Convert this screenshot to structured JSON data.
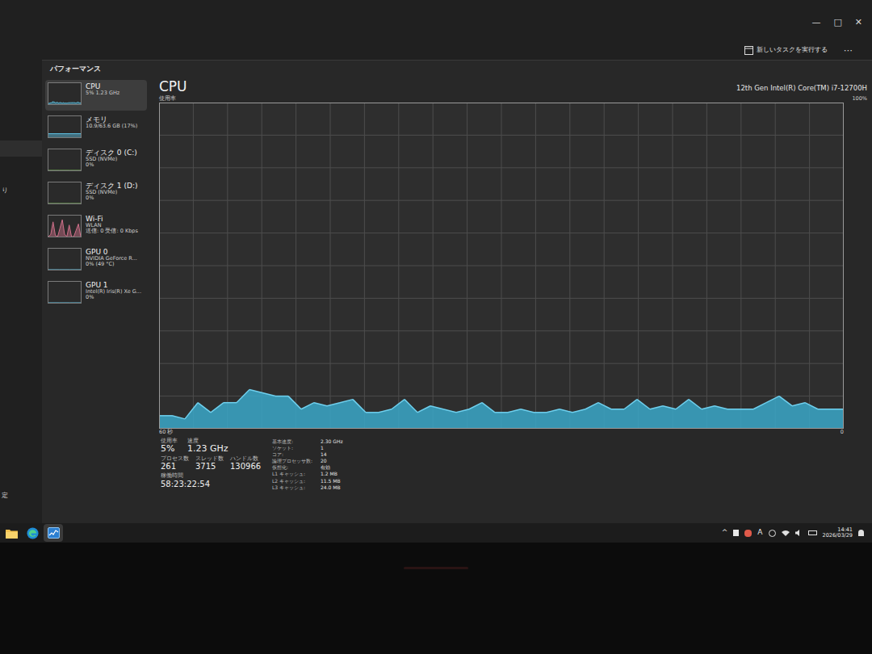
{
  "window": {
    "controls": [
      "—",
      "□",
      "✕"
    ]
  },
  "command_bar": {
    "run_task": "新しいタスクを実行する",
    "more": "⋯"
  },
  "nav_strip": [
    "り",
    "定"
  ],
  "page": {
    "title": "パフォーマンス"
  },
  "sidebar": {
    "items": [
      {
        "name": "CPU",
        "lines": [
          "5% 1.23 GHz"
        ],
        "selected": true,
        "color": "#5fc3e4",
        "graph": [
          4,
          4,
          3,
          8,
          5,
          8,
          8,
          12,
          11,
          10,
          10,
          6,
          8,
          7,
          8,
          9,
          5,
          5,
          6,
          9,
          5,
          7,
          6,
          5,
          6,
          8,
          5,
          5,
          6,
          5,
          5,
          6,
          5,
          6,
          8,
          6,
          6,
          9,
          6,
          7,
          6,
          9,
          6,
          7,
          6,
          6,
          6,
          8,
          10,
          7,
          8,
          6,
          6,
          6
        ]
      },
      {
        "name": "メモリ",
        "lines": [
          "10.9/63.6 GB (17%)"
        ],
        "selected": false,
        "color": "#5fc3e4",
        "graph": [
          17,
          17,
          17,
          17,
          17,
          17
        ]
      },
      {
        "name": "ディスク 0 (C:)",
        "lines": [
          "SSD (NVMe)",
          "0%"
        ],
        "selected": false,
        "color": "#7fbf5f",
        "graph": [
          0,
          0,
          0,
          0
        ]
      },
      {
        "name": "ディスク 1 (D:)",
        "lines": [
          "SSD (NVMe)",
          "0%"
        ],
        "selected": false,
        "color": "#7fbf5f",
        "graph": [
          0,
          0,
          0,
          0
        ]
      },
      {
        "name": "Wi-Fi",
        "lines": [
          "WLAN",
          "送信: 0 受信: 0 Kbps"
        ],
        "selected": false,
        "color": "#d0708a",
        "graph": [
          0,
          10,
          70,
          5,
          0,
          40,
          80,
          10,
          0,
          55,
          0,
          0,
          30,
          60,
          0
        ]
      },
      {
        "name": "GPU 0",
        "lines": [
          "NVIDIA GeForce R...",
          "0% (49 °C)"
        ],
        "selected": false,
        "color": "#5fc3e4",
        "graph": [
          0,
          0,
          0,
          0
        ]
      },
      {
        "name": "GPU 1",
        "lines": [
          "Intel(R) Iris(R) Xe G...",
          "0%"
        ],
        "selected": false,
        "color": "#5fc3e4",
        "graph": [
          0,
          0,
          0,
          0
        ]
      }
    ]
  },
  "cpu": {
    "title": "CPU",
    "model": "12th Gen Intel(R) Core(TM) i7-12700H",
    "axis_label": "使用率",
    "max": "100%",
    "x_start": "60 秒",
    "x_end": "0",
    "series": [
      4,
      4,
      3,
      8,
      5,
      8,
      8,
      12,
      11,
      10,
      10,
      6,
      8,
      7,
      8,
      9,
      5,
      5,
      6,
      9,
      5,
      7,
      6,
      5,
      6,
      8,
      5,
      5,
      6,
      5,
      5,
      6,
      5,
      6,
      8,
      6,
      6,
      9,
      6,
      7,
      6,
      9,
      6,
      7,
      6,
      6,
      6,
      8,
      10,
      7,
      8,
      6,
      6,
      6
    ],
    "metrics_row1": [
      {
        "label": "使用率",
        "value": "5%"
      },
      {
        "label": "速度",
        "value": "1.23 GHz"
      }
    ],
    "metrics_row2": [
      {
        "label": "プロセス数",
        "value": "261"
      },
      {
        "label": "スレッド数",
        "value": "3715"
      },
      {
        "label": "ハンドル数",
        "value": "130966"
      }
    ],
    "uptime": {
      "label": "稼働時間",
      "value": "58:23:22:54"
    },
    "specs": [
      {
        "label": "基本速度:",
        "value": "2.30 GHz"
      },
      {
        "label": "ソケット:",
        "value": "1"
      },
      {
        "label": "コア:",
        "value": "14"
      },
      {
        "label": "論理プロセッサ数:",
        "value": "20"
      },
      {
        "label": "仮想化:",
        "value": "有効"
      },
      {
        "label": "L1 キャッシュ:",
        "value": "1.2 MB"
      },
      {
        "label": "L2 キャッシュ:",
        "value": "11.5 MB"
      },
      {
        "label": "L3 キャッシュ:",
        "value": "24.0 MB"
      }
    ]
  },
  "taskbar": {
    "apps": [
      {
        "kind": "folder",
        "selected": false
      },
      {
        "kind": "edge",
        "selected": false
      },
      {
        "kind": "taskmgr",
        "selected": true
      }
    ],
    "chevron": "^",
    "ime": "A",
    "time": "14:41",
    "date": "2026/03/29"
  }
}
